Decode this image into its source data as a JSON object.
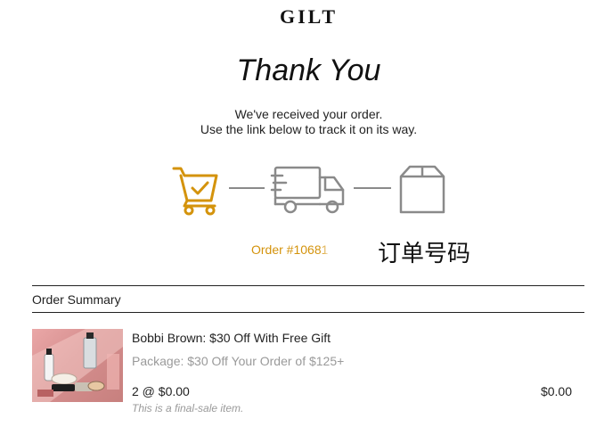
{
  "brand": {
    "logo_text": "GILT"
  },
  "header": {
    "title": "Thank You",
    "message_line1": "We've received your order.",
    "message_line2": "Use the link below to track it on its way."
  },
  "tracker": {
    "steps": [
      {
        "icon": "cart-check-icon",
        "state": "active",
        "color": "#d4930c"
      },
      {
        "icon": "delivery-truck-icon",
        "state": "pending",
        "color": "#8a8a8a"
      },
      {
        "icon": "package-box-icon",
        "state": "pending",
        "color": "#8a8a8a"
      }
    ]
  },
  "order": {
    "number_text": "Order #10681",
    "annotation": "订单号码",
    "accent_color": "#d4930c"
  },
  "summary": {
    "heading": "Order Summary",
    "items": [
      {
        "thumbnail": "bobbi-brown-product-photo",
        "name": "Bobbi Brown: $30 Off With Free Gift",
        "package": "Package: $30 Off Your Order of $125+",
        "quantity_price": "2 @ $0.00",
        "total": "$0.00",
        "note": "This is a final-sale item."
      }
    ]
  }
}
